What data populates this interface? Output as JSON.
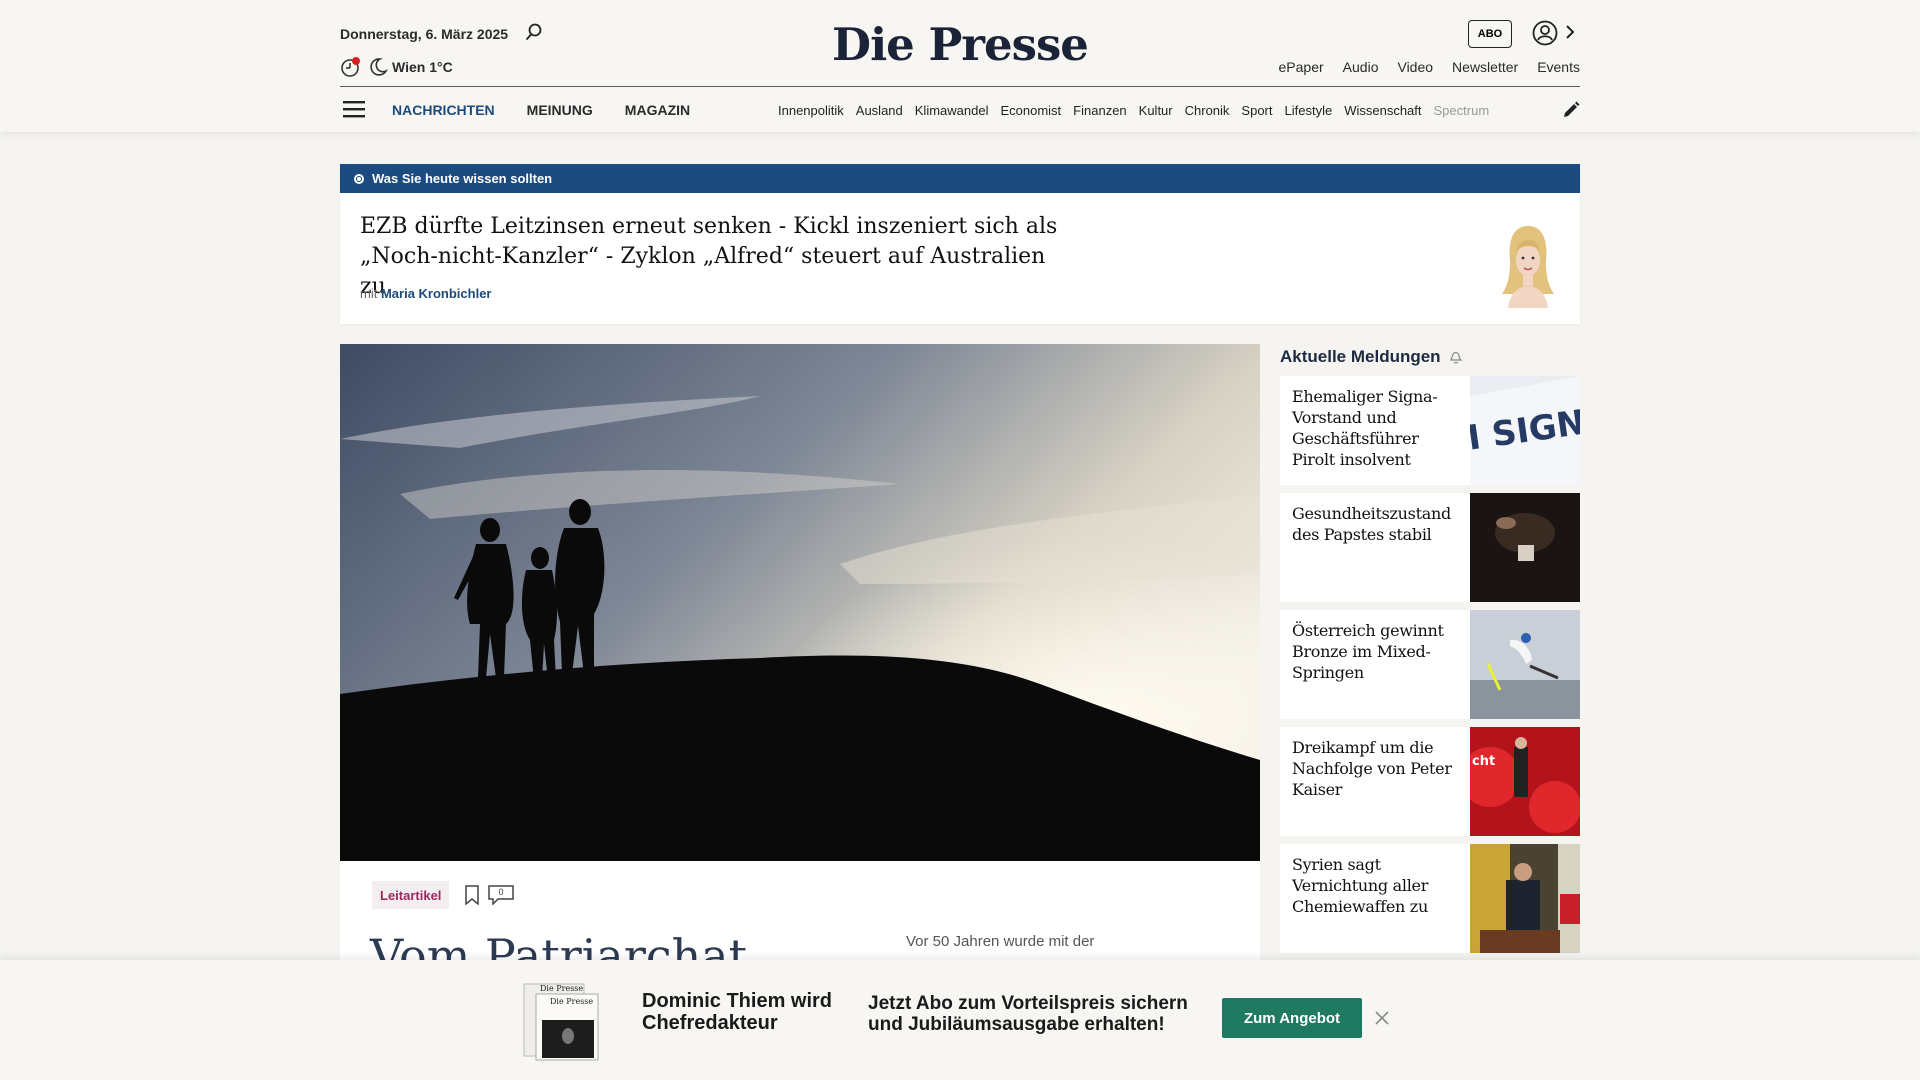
{
  "header": {
    "date": "Donnerstag, 6. März 2025",
    "weather": "Wien 1°C",
    "logo": "Die Presse",
    "abo_label": "ABO",
    "util_links": [
      "ePaper",
      "Audio",
      "Video",
      "Newsletter",
      "Events"
    ],
    "main_nav": [
      "NACHRICHTEN",
      "MEINUNG",
      "MAGAZIN"
    ],
    "sub_nav": [
      "Innenpolitik",
      "Ausland",
      "Klimawandel",
      "Economist",
      "Finanzen",
      "Kultur",
      "Chronik",
      "Sport",
      "Lifestyle",
      "Wissenschaft",
      "Spectrum"
    ]
  },
  "teaser": {
    "bar_label": "Was Sie heute wissen sollten",
    "headline_1": "EZB dürfte Leitzinsen erneut senken - Kickl inszeniert sich als",
    "headline_2": "„Noch-nicht-Kanzler“ - Zyklon „Alfred“ steuert auf Australien zu",
    "by_prefix": "mit",
    "author": "Maria Kronbichler"
  },
  "article": {
    "badge": "Leitartikel",
    "comment_count": "0",
    "title": "Vom Patriarchat",
    "lede": "Vor 50 Jahren wurde mit der"
  },
  "sidebar": {
    "title": "Aktuelle Meldungen",
    "items": [
      {
        "text": "Ehemaliger Signa-Vorstand und Geschäftsführer Pirolt insolvent"
      },
      {
        "text": "Gesundheitszustand des Papstes stabil"
      },
      {
        "text": "Österreich gewinnt Bronze im Mixed-Springen"
      },
      {
        "text": "Dreikampf um die Nachfolge von Peter Kaiser"
      },
      {
        "text": "Syrien sagt Vernichtung aller Chemiewaffen zu"
      }
    ]
  },
  "promo": {
    "name_line": "Dominic Thiem wird Chefredakteur",
    "offer_text": "Jetzt Abo zum Vorteilspreis sichern und Jubiläumsausgabe erhalten!",
    "button": "Zum Angebot",
    "mini_logo": "Die Presse"
  },
  "colors": {
    "brand_blue": "#1c4b7f",
    "promo_green": "#1f7a61",
    "badge_text": "#9a2a5a"
  }
}
